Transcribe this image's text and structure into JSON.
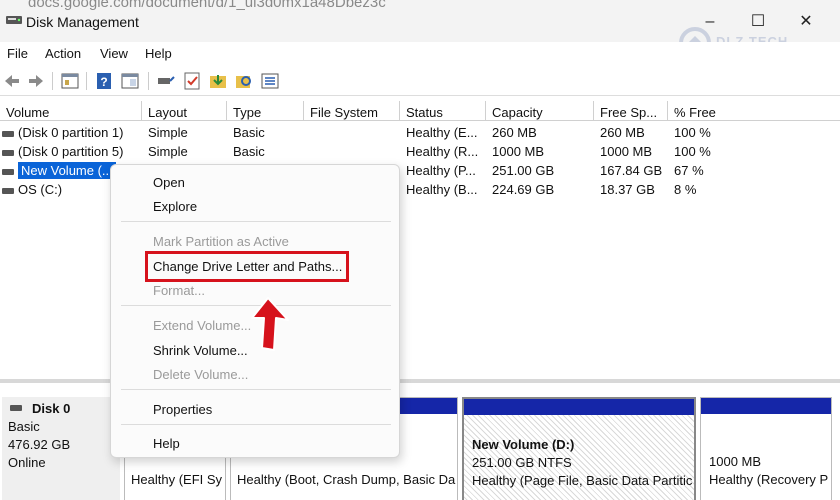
{
  "window": {
    "url_ghost": "docs.google.com/document/d/1_ul3d0mx1a48Dbez3c",
    "title": "Disk Management",
    "controls": [
      "–",
      "☐",
      "✕"
    ]
  },
  "menu": [
    "File",
    "Action",
    "View",
    "Help"
  ],
  "watermark": "DLZ TECH",
  "columns": [
    "Volume",
    "Layout",
    "Type",
    "File System",
    "Status",
    "Capacity",
    "Free Sp...",
    "% Free"
  ],
  "rows": [
    {
      "volume": "(Disk 0 partition 1)",
      "layout": "Simple",
      "type": "Basic",
      "fs": "",
      "status": "Healthy (E...",
      "capacity": "260 MB",
      "free": "260 MB",
      "pct": "100 %"
    },
    {
      "volume": "(Disk 0 partition 5)",
      "layout": "Simple",
      "type": "Basic",
      "fs": "",
      "status": "Healthy (R...",
      "capacity": "1000 MB",
      "free": "1000 MB",
      "pct": "100 %"
    },
    {
      "volume": "New Volume (...",
      "layout": "",
      "type": "",
      "fs": "",
      "status": "Healthy (P...",
      "capacity": "251.00 GB",
      "free": "167.84 GB",
      "pct": "67 %"
    },
    {
      "volume": "OS (C:)",
      "layout": "",
      "type": "",
      "fs": "",
      "status": "Healthy (B...",
      "capacity": "224.69 GB",
      "free": "18.37 GB",
      "pct": "8 %"
    }
  ],
  "disk": {
    "name": "Disk 0",
    "kind": "Basic",
    "size": "476.92 GB",
    "state": "Online"
  },
  "partitions": [
    {
      "line1": "",
      "line2": "",
      "status": "Healthy (EFI Sy"
    },
    {
      "line1": "",
      "line2": "",
      "status": "Healthy (Boot, Crash Dump, Basic Da"
    },
    {
      "line1": "New Volume  (D:)",
      "line2": "251.00 GB NTFS",
      "status": "Healthy (Page File, Basic Data Partitic"
    },
    {
      "line1": "",
      "line2": "1000 MB",
      "status": "Healthy (Recovery P"
    }
  ],
  "context_menu": {
    "open": "Open",
    "explore": "Explore",
    "mark_active": "Mark Partition as Active",
    "change_letter": "Change Drive Letter and Paths...",
    "format": "Format...",
    "extend": "Extend Volume...",
    "shrink": "Shrink Volume...",
    "delete": "Delete Volume...",
    "properties": "Properties",
    "help": "Help"
  },
  "colors": {
    "selection": "#0a64d8",
    "partition_band": "#1526a8",
    "annotation": "#d6121c"
  }
}
